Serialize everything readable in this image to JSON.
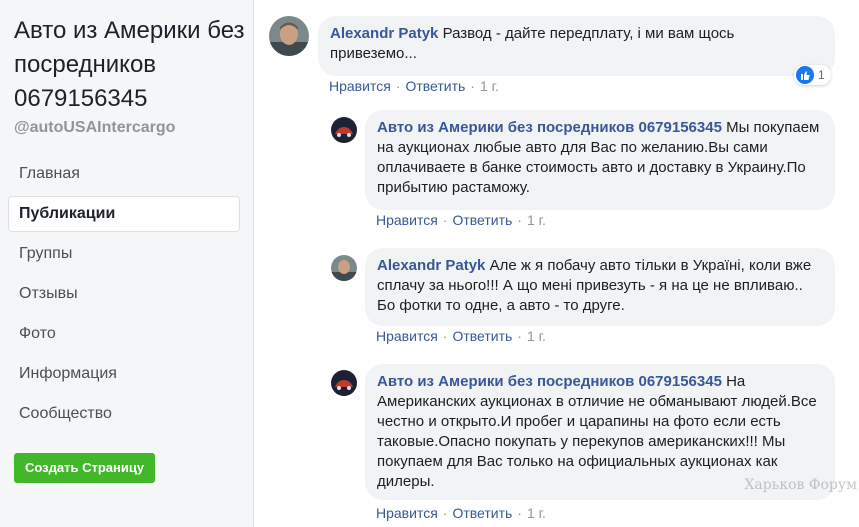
{
  "sidebar": {
    "page_name": "Авто из Америки без посредников 0679156345",
    "handle": "@autoUSAIntercargo",
    "nav": [
      {
        "label": "Главная"
      },
      {
        "label": "Публикации"
      },
      {
        "label": "Группы"
      },
      {
        "label": "Отзывы"
      },
      {
        "label": "Фото"
      },
      {
        "label": "Информация"
      },
      {
        "label": "Сообщество"
      }
    ],
    "create_page_label": "Создать Страницу"
  },
  "comments": [
    {
      "author": "Alexandr Patyk",
      "text": "Развод - дайте передплату, і ми вам щось привеземо...",
      "like_label": "Нравится",
      "reply_label": "Ответить",
      "time": "1 г.",
      "reaction_count": "1"
    },
    {
      "author": "Авто из Америки без посредников 0679156345",
      "text": "Мы покупаем на аукционах любые авто для Вас по желанию.Вы сами оплачиваете в банке стоимость авто и доставку в Украину.По прибытию растаможу.",
      "like_label": "Нравится",
      "reply_label": "Ответить",
      "time": "1 г."
    },
    {
      "author": "Alexandr Patyk",
      "text": "Але ж я побачу авто тільки в Україні, коли вже сплачу за нього!!! А що мені привезуть - я на це не впливаю.. Бо фотки то одне, а авто - то друге.",
      "like_label": "Нравится",
      "reply_label": "Ответить",
      "time": "1 г."
    },
    {
      "author": "Авто из Америки без посредников 0679156345",
      "text": "На Американских аукционах в отличие не обманывают людей.Все честно и открыто.И пробег и царапины на фото если есть таковые.Опасно покупать у перекупов американских!!! Мы покупаем для Вас только на официальных аукционах как дилеры.",
      "like_label": "Нравится",
      "reply_label": "Ответить",
      "time": "1 г."
    }
  ],
  "watermark": "Харьков Форум",
  "colors": {
    "link": "#385898",
    "bubble": "#f2f3f5",
    "create_button": "#42b72a",
    "like": "#1877f2"
  }
}
